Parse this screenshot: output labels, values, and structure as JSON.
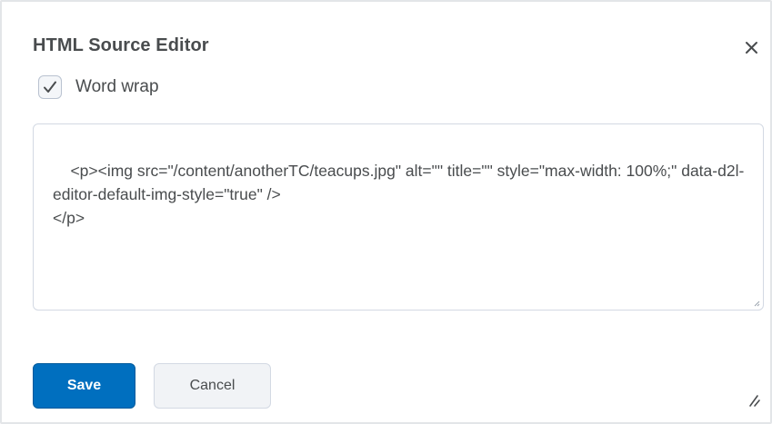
{
  "dialog": {
    "title": "HTML Source Editor",
    "close_icon": "close-icon"
  },
  "word_wrap": {
    "label": "Word wrap",
    "checked": true,
    "icon": "checkmark-icon"
  },
  "editor": {
    "content": "<p><img src=\"/content/anotherTC/teacups.jpg\" alt=\"\" title=\"\" style=\"max-width: 100%;\" data-d2l-editor-default-img-style=\"true\" />\n</p>"
  },
  "buttons": {
    "save_label": "Save",
    "cancel_label": "Cancel"
  },
  "colors": {
    "primary": "#006fbf",
    "text": "#494c4e",
    "border": "#d3d9e3"
  }
}
